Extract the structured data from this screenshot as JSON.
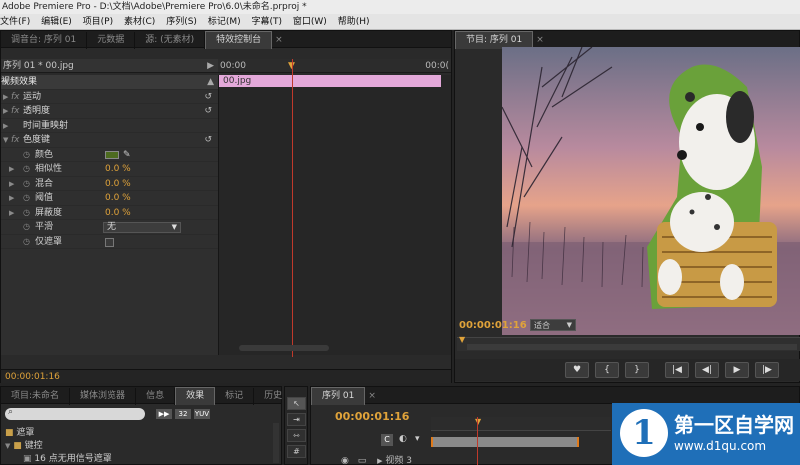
{
  "window": {
    "title": "Adobe Premiere Pro - D:\\文档\\Adobe\\Premiere Pro\\6.0\\未命名.prproj *"
  },
  "menu": [
    "文件(F)",
    "编辑(E)",
    "项目(P)",
    "素材(C)",
    "序列(S)",
    "标记(M)",
    "字幕(T)",
    "窗口(W)",
    "帮助(H)"
  ],
  "left_panel": {
    "tabs": [
      "调音台: 序列 01",
      "元数据",
      "源: (无素材)",
      "特效控制台"
    ],
    "active_tab": "特效控制台",
    "clip_header": "序列 01 * 00.jpg",
    "timeline_start": "00:00",
    "timeline_end": "00:0(",
    "clip_name": "00.jpg",
    "section": "视频效果",
    "effects": [
      {
        "name": "运动"
      },
      {
        "name": "透明度"
      },
      {
        "name": "时间重映射"
      },
      {
        "name": "色度键"
      }
    ],
    "params": [
      {
        "name": "颜色",
        "value": ""
      },
      {
        "name": "相似性",
        "value": "0.0 %"
      },
      {
        "name": "混合",
        "value": "0.0 %"
      },
      {
        "name": "阈值",
        "value": "0.0 %"
      },
      {
        "name": "屏蔽度",
        "value": "0.0 %"
      },
      {
        "name": "平滑",
        "value": "无"
      },
      {
        "name": "仅遮罩",
        "value": ""
      }
    ],
    "key_color": "#4d6b1f",
    "footer_timecode": "00:00:01:16"
  },
  "program_monitor": {
    "tab": "节目: 序列 01",
    "timecode": "00:00:01:16",
    "fit": "适合"
  },
  "project_panel": {
    "tabs": [
      "项目:未命名",
      "媒体浏览器",
      "信息",
      "效果",
      "标记",
      "历史"
    ],
    "active_tab": "效果",
    "items": [
      "遮罩",
      "键控",
      "16 点无用信号遮罩"
    ]
  },
  "sequence_panel": {
    "tab": "序列 01",
    "timecode": "00:00:01:16",
    "track": "视频 3"
  },
  "watermark": {
    "title": "第一区自学网",
    "url": "www.d1qu.com"
  }
}
